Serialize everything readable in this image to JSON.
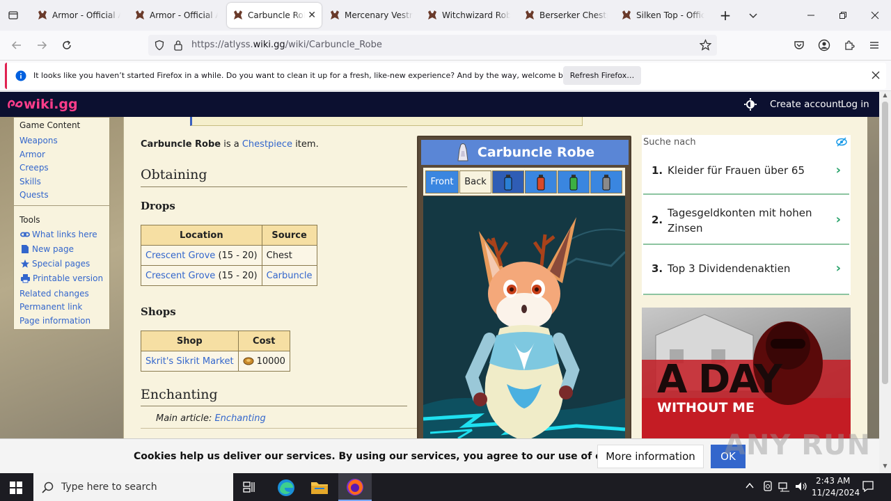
{
  "browser": {
    "tabs": [
      {
        "title": "Armor - Official Atlyss Wiki",
        "active": false
      },
      {
        "title": "Armor - Official Atlyss Wiki",
        "active": false
      },
      {
        "title": "Carbuncle Robe - Official",
        "active": true
      },
      {
        "title": "Mercenary Vestment - Of",
        "active": false
      },
      {
        "title": "Witchwizard Robe - Offi",
        "active": false
      },
      {
        "title": "Berserker Chestpiece",
        "active": false
      },
      {
        "title": "Silken Top - Official Atl",
        "active": false
      }
    ],
    "url_prefix": "https://atlyss.",
    "url_domain": "wiki.gg",
    "url_path": "/wiki/Carbuncle_Robe",
    "notification": {
      "text": "It looks like you haven’t started Firefox in a while. Do you want to clean it up for a fresh, like-new experience? And by the way, welcome back!",
      "button": "Refresh Firefox…"
    }
  },
  "wiki_header": {
    "logo": "wiki.gg",
    "create_account": "Create account",
    "login": "Log in"
  },
  "sidebar": {
    "section_title": "Game Content",
    "content_links": [
      "Weapons",
      "Armor",
      "Creeps",
      "Skills",
      "Quests"
    ],
    "tools_title": "Tools",
    "tools": [
      {
        "label": "What links here",
        "icon": "link-icon"
      },
      {
        "label": "New page",
        "icon": "page-icon"
      },
      {
        "label": "Special pages",
        "icon": "star-icon"
      },
      {
        "label": "Printable version",
        "icon": "printer-icon"
      },
      {
        "label": "Related changes",
        "icon": ""
      },
      {
        "label": "Permanent link",
        "icon": ""
      },
      {
        "label": "Page information",
        "icon": ""
      }
    ]
  },
  "article": {
    "intro_name": "Carbuncle Robe",
    "intro_mid": " is a ",
    "intro_link": "Chestpiece",
    "intro_end": " item.",
    "h_obtaining": "Obtaining",
    "h_drops": "Drops",
    "drops_headers": [
      "Location",
      "Source"
    ],
    "drops_rows": [
      {
        "location": "Crescent Grove",
        "level": " (15 - 20)",
        "source": "Chest",
        "source_link": false
      },
      {
        "location": "Crescent Grove",
        "level": " (15 - 20)",
        "source": "Carbuncle",
        "source_link": true
      }
    ],
    "h_shops": "Shops",
    "shops_headers": [
      "Shop",
      "Cost"
    ],
    "shops_rows": [
      {
        "shop": "Skrit's Sikrit Market",
        "cost": "10000"
      }
    ],
    "h_enchanting": "Enchanting",
    "main_article_label": "Main article: ",
    "main_article_link": "Enchanting"
  },
  "infobox": {
    "title": "Carbuncle Robe",
    "tab_front": "Front",
    "tab_back": "Back",
    "dye_colors": [
      "#2a7fd4",
      "#d94a2a",
      "#3cb043",
      "#8a8a8a"
    ]
  },
  "ad": {
    "search_label": "Suche nach",
    "items": [
      {
        "num": "1.",
        "text": "Kleider für Frauen über 65"
      },
      {
        "num": "2.",
        "text": "Tagesgeldkonten mit hohen Zinsen"
      },
      {
        "num": "3.",
        "text": "Top 3 Dividendenaktien"
      }
    ],
    "banner_line1": "A DAY",
    "banner_line2": "WITHOUT ME"
  },
  "cookie": {
    "text": "Cookies help us deliver our services. By using our services, you agree to our use of cookies.",
    "more": "More information",
    "ok": "OK"
  },
  "watermark": "ANY RUN",
  "taskbar": {
    "search_placeholder": "Type here to search",
    "time": "2:43 AM",
    "date": "11/24/2024"
  }
}
